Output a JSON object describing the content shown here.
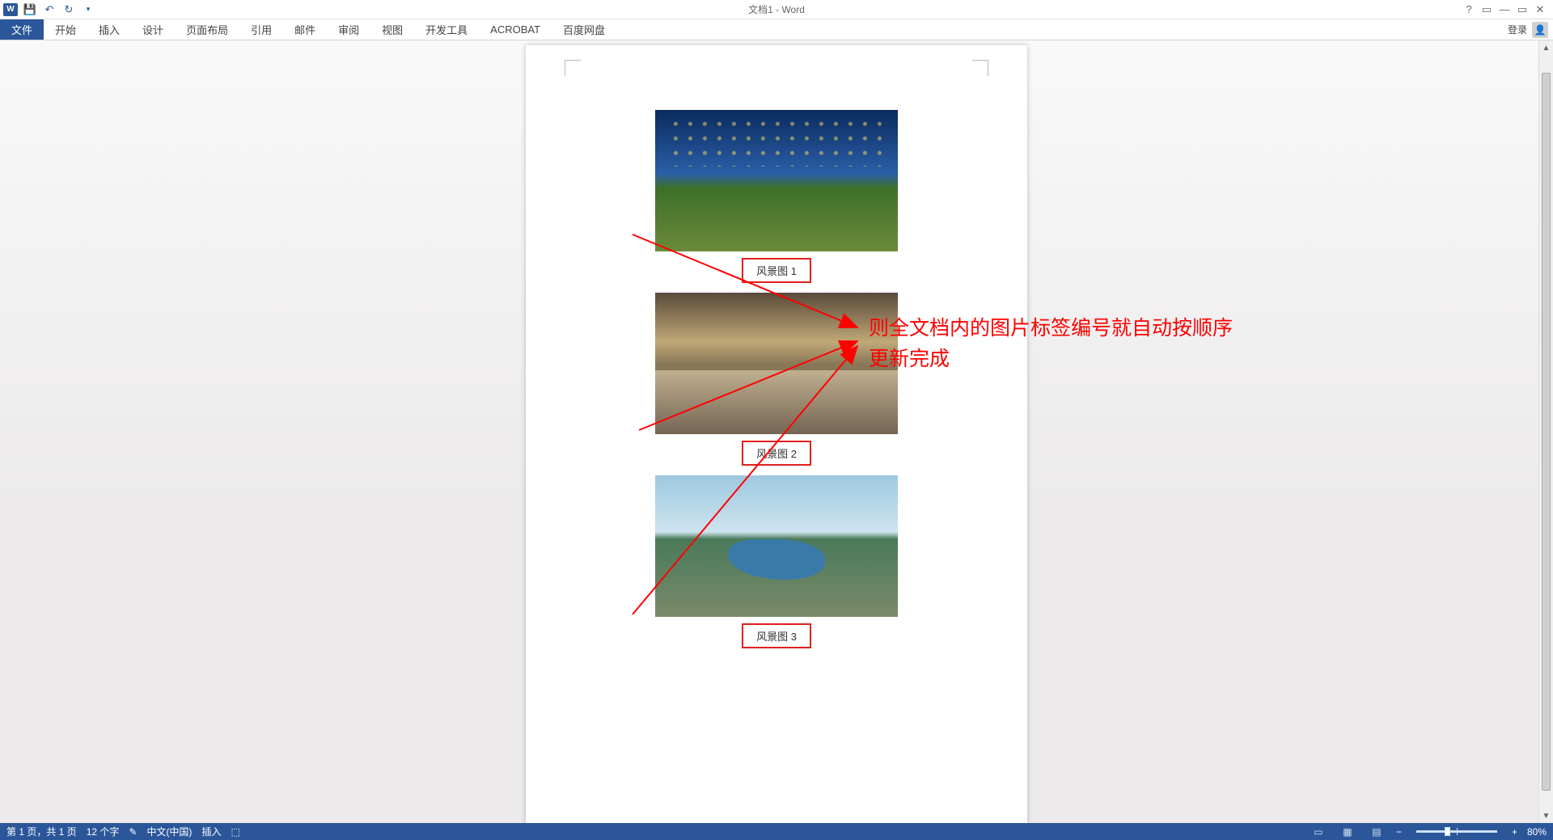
{
  "title": "文档1 - Word",
  "qat": {
    "save": "save-icon",
    "undo": "undo-icon",
    "redo": "redo-icon"
  },
  "win": {
    "help": "?",
    "ribbonopts": "▭",
    "min": "—",
    "restore": "▭",
    "close": "✕"
  },
  "tabs": [
    "文件",
    "开始",
    "插入",
    "设计",
    "页面布局",
    "引用",
    "邮件",
    "审阅",
    "视图",
    "开发工具",
    "ACROBAT",
    "百度网盘"
  ],
  "active_tab": 0,
  "signin": "登录",
  "captions": [
    "风景图 1",
    "风景图 2",
    "风景图 3"
  ],
  "annotation": {
    "line1": "则全文档内的图片标签编号就自动按顺序",
    "line2": "更新完成"
  },
  "status": {
    "page": "第 1 页，共 1 页",
    "words": "12 个字",
    "proof": "✎",
    "lang": "中文(中国)",
    "mode": "插入",
    "macro": "⬚",
    "zoom": "80%",
    "zoom_minus": "−",
    "zoom_plus": "+"
  }
}
